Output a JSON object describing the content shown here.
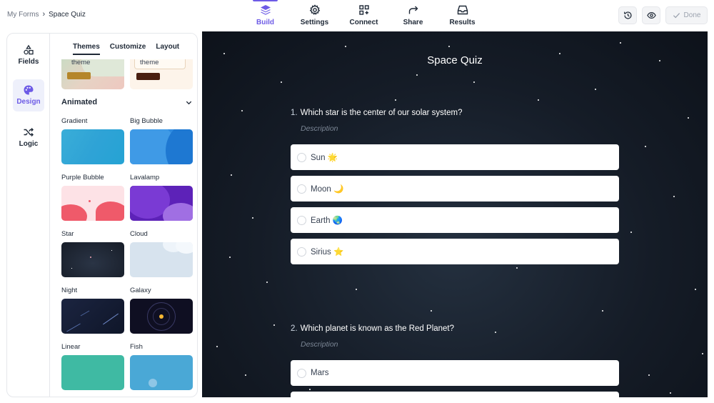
{
  "breadcrumb": {
    "root": "My Forms",
    "separator": "›",
    "current": "Space Quiz"
  },
  "nav": {
    "tabs": [
      {
        "label": "Build",
        "icon": "layers-icon",
        "active": true
      },
      {
        "label": "Settings",
        "icon": "gear-icon"
      },
      {
        "label": "Connect",
        "icon": "grid-plus-icon"
      },
      {
        "label": "Share",
        "icon": "share-arrow-icon"
      },
      {
        "label": "Results",
        "icon": "inbox-icon"
      }
    ]
  },
  "actions": {
    "history_icon": "history-icon",
    "preview_icon": "eye-icon",
    "done_label": "Done"
  },
  "sidebar": {
    "rail": [
      {
        "label": "Fields",
        "icon": "shapes-icon"
      },
      {
        "label": "Design",
        "icon": "palette-icon",
        "active": true
      },
      {
        "label": "Logic",
        "icon": "shuffle-icon"
      }
    ],
    "subtabs": [
      "Themes",
      "Customize",
      "Layout"
    ],
    "active_subtab": "Themes",
    "partial_themes": [
      {
        "label": "theme"
      },
      {
        "label": "theme"
      }
    ],
    "section_title": "Animated",
    "themes": [
      {
        "name": "Gradient"
      },
      {
        "name": "Big Bubble"
      },
      {
        "name": "Purple Bubble"
      },
      {
        "name": "Lavalamp"
      },
      {
        "name": "Star"
      },
      {
        "name": "Cloud"
      },
      {
        "name": "Night"
      },
      {
        "name": "Galaxy"
      },
      {
        "name": "Linear"
      },
      {
        "name": "Fish"
      }
    ]
  },
  "colors": {
    "accent": "#6d5be6",
    "canvas_bg": "#151c27"
  },
  "form": {
    "title": "Space Quiz",
    "questions": [
      {
        "number": "1.",
        "text": "Which star is the center of our solar system?",
        "description": "Description",
        "options": [
          "Sun 🌟",
          "Moon 🌙",
          "Earth 🌏",
          "Sirius ⭐"
        ]
      },
      {
        "number": "2.",
        "text": "Which planet is known as the Red Planet?",
        "description": "Description",
        "options": [
          "Mars"
        ]
      }
    ]
  }
}
